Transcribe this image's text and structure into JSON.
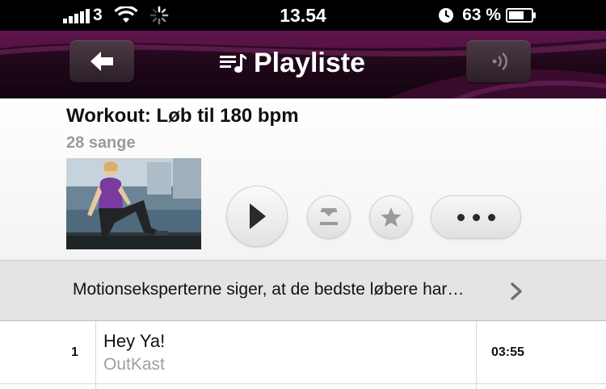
{
  "status_bar": {
    "carrier": "3",
    "time": "13.54",
    "battery_percent": "63 %",
    "icons": [
      "signal-bars-icon",
      "wifi-icon",
      "activity-spinner-icon",
      "clock-icon",
      "battery-icon"
    ]
  },
  "nav": {
    "title": "Playliste",
    "back_icon": "back-arrow-icon",
    "title_icon": "playlist-icon",
    "right_icon": "speaker-icon"
  },
  "playlist": {
    "title": "Workout: Løb til 180 bpm",
    "count": "28 sange",
    "description": "Motionseksperterne siger, at de bedste løbere har…",
    "actions": [
      "play-icon",
      "download-icon",
      "star-icon",
      "more-icon"
    ]
  },
  "tracks": [
    {
      "number": "1",
      "title": "Hey Ya!",
      "artist": "OutKast",
      "duration": "03:55"
    }
  ],
  "colors": {
    "nav_bg": "#22081b",
    "accent_magenta": "#8a1a6a",
    "text_primary": "#111111",
    "text_secondary": "#9a9a9a"
  }
}
